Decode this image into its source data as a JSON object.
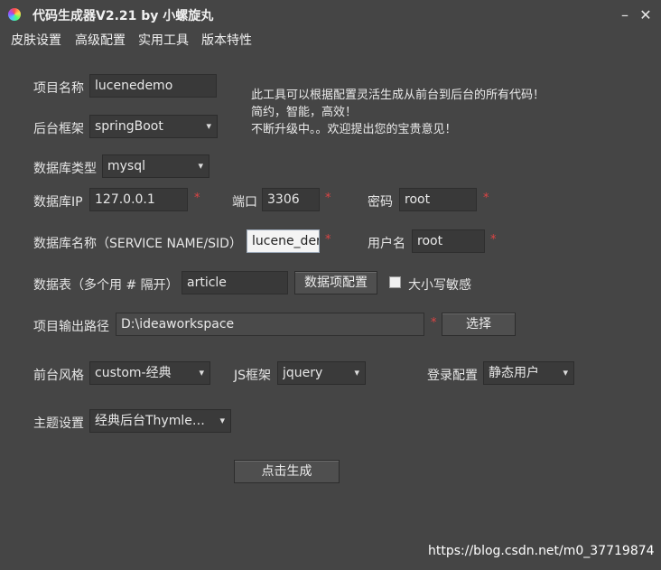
{
  "window": {
    "title": "代码生成器V2.21 by 小螺旋丸",
    "minimize": "–",
    "close": "✕"
  },
  "menu": {
    "items": [
      "皮肤设置",
      "高级配置",
      "实用工具",
      "版本特性"
    ]
  },
  "info": {
    "lines": [
      "此工具可以根据配置灵活生成从前台到后台的所有代码！",
      "简约，智能，高效！",
      "不断升级中。。欢迎提出您的宝贵意见！"
    ]
  },
  "form": {
    "project_name": {
      "label": "项目名称",
      "value": "lucenedemo"
    },
    "backend_framework": {
      "label": "后台框架",
      "value": "springBoot"
    },
    "db_type": {
      "label": "数据库类型",
      "value": "mysql"
    },
    "db_ip": {
      "label": "数据库IP",
      "value": "127.0.0.1",
      "required": "*"
    },
    "port": {
      "label": "端口",
      "value": "3306",
      "required": "*"
    },
    "password": {
      "label": "密码",
      "value": "root",
      "required": "*"
    },
    "db_name": {
      "label": "数据库名称（SERVICE NAME/SID）",
      "value": "lucene_der",
      "required": "*"
    },
    "username": {
      "label": "用户名",
      "value": "root",
      "required": "*"
    },
    "tables": {
      "label": "数据表（多个用 # 隔开）",
      "value": "article"
    },
    "column_config_button": "数据项配置",
    "case_sensitive": {
      "label": "大小写敏感",
      "checked": false
    },
    "output_path": {
      "label": "项目输出路径",
      "value": "D:\\ideaworkspace",
      "required": "*"
    },
    "choose_button": "选择",
    "frontend_style": {
      "label": "前台风格",
      "value": "custom-经典"
    },
    "js_framework": {
      "label": "JS框架",
      "value": "jquery"
    },
    "login_config": {
      "label": "登录配置",
      "value": "静态用户"
    },
    "theme": {
      "label": "主题设置",
      "value": "经典后台Thymleaf版"
    },
    "generate_button": "点击生成"
  },
  "watermark": "https://blog.csdn.net/m0_37719874",
  "icons": {
    "dropdown": "▾"
  }
}
